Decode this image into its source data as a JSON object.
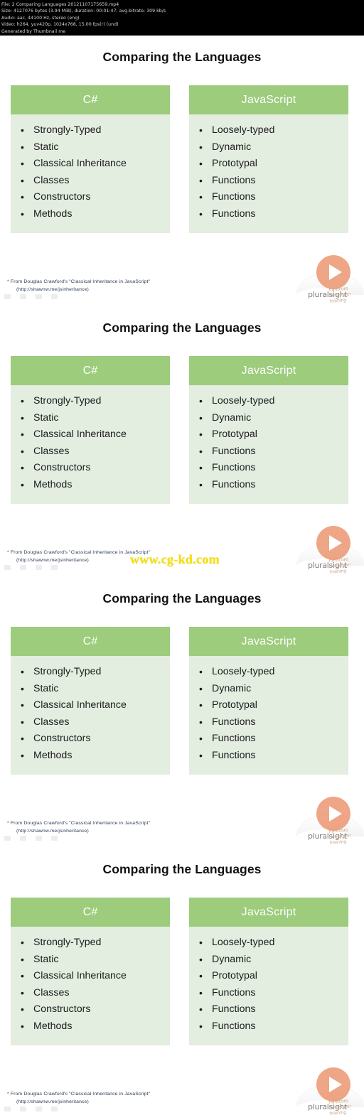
{
  "media_info": {
    "lines": [
      "File: 2 Comparing Languages 20121107175659.mp4",
      "Size: 4127076 bytes (3.94 MiB), duration: 00:01:47, avg.bitrate: 309 kb/s",
      "Audio: aac, 44100 Hz, stereo (eng)",
      "Video: h264, yuv420p, 1024x768, 15.00 fps(r) (und)",
      "Generated by Thumbnail me"
    ]
  },
  "slide": {
    "title": "Comparing the Languages",
    "columns": [
      {
        "header": "C#",
        "items": [
          "Strongly-Typed",
          "Static",
          "Classical Inheritance",
          "Classes",
          "Constructors",
          "Methods"
        ]
      },
      {
        "header": "JavaScript",
        "items": [
          "Loosely-typed",
          "Dynamic",
          "Prototypal",
          "Functions",
          "Functions",
          "Functions"
        ]
      }
    ],
    "footnote_line1": "* From Douglas Crawford's \"Classical Inheritance in JavaScript\"",
    "footnote_line2": "(http://shawnw.me/jsinheritance)"
  },
  "branding": {
    "logo_name": "pluralsight",
    "logo_subtext": "hardcore developer training",
    "play_icon": "play-triangle-icon"
  },
  "watermark": {
    "text": "www.cg-kd.com"
  },
  "colors": {
    "header_green": "#9ccc7c",
    "body_green": "#e3ede0",
    "title_black": "#111111",
    "footnote_blue": "#2b3a55",
    "play_orange": "#e88458",
    "watermark_yellow": "#f5e000",
    "infobar_bg": "#000000"
  }
}
